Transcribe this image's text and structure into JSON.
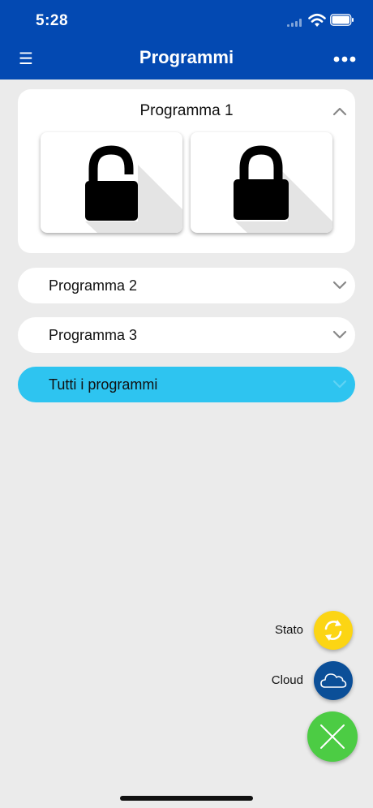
{
  "status_bar": {
    "time": "5:28",
    "icons": [
      "cellular-signal-icon",
      "wifi-icon",
      "battery-icon"
    ]
  },
  "navbar": {
    "menu_icon": "☰",
    "title": "Programmi",
    "more_icon": "more-dots-icon"
  },
  "programs": [
    {
      "label": "Programma 1",
      "expanded": true,
      "actions": [
        {
          "name": "unlock",
          "icon": "unlocked-padlock-icon"
        },
        {
          "name": "lock",
          "icon": "locked-padlock-icon"
        }
      ]
    },
    {
      "label": "Programma 2",
      "expanded": false
    },
    {
      "label": "Programma 3",
      "expanded": false
    },
    {
      "label": "Tutti i programmi",
      "expanded": false
    }
  ],
  "fab_menu": {
    "items": [
      {
        "label": "Stato",
        "icon": "refresh-icon",
        "color": "#fcd514"
      },
      {
        "label": "Cloud",
        "icon": "cloud-icon",
        "color": "#0b4f98"
      }
    ],
    "close": {
      "icon": "close-icon",
      "color": "#4ccc44"
    }
  },
  "colors": {
    "header": "#0349b2",
    "background": "#ebebeb",
    "highlight_row": "#2ec4f0"
  }
}
